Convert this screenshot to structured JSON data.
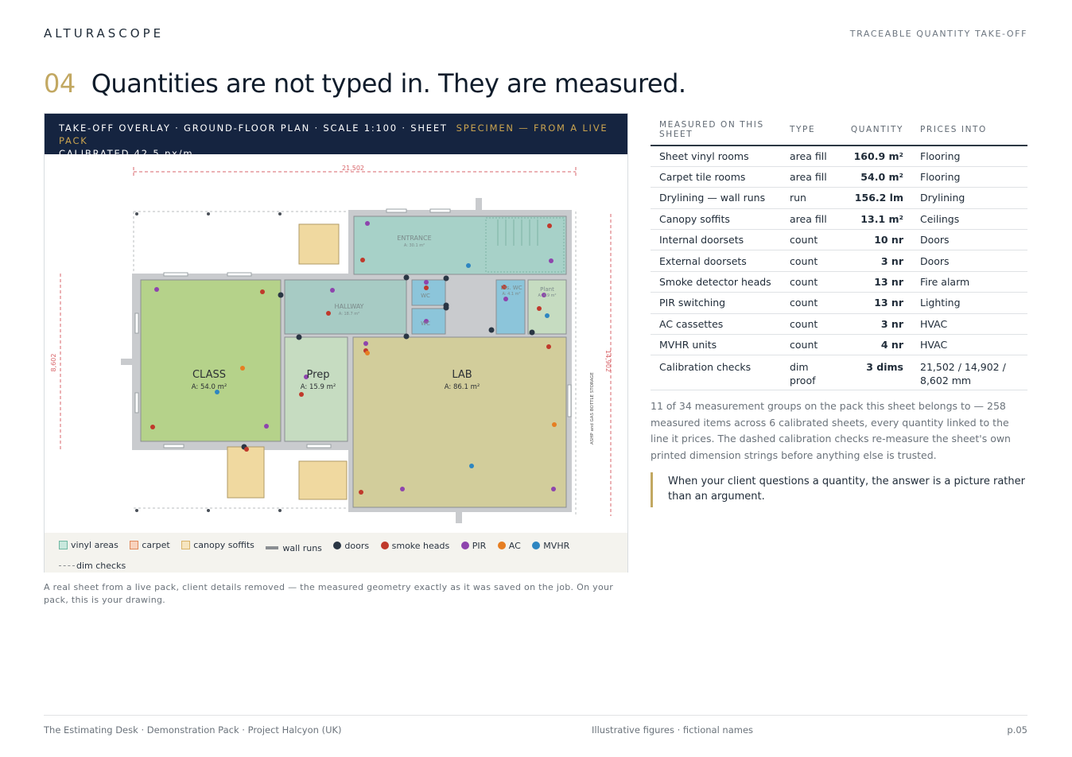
{
  "brand": "ALTURASCOPE",
  "kicker": "TRACEABLE QUANTITY TAKE-OFF",
  "headline": {
    "number": "04",
    "text": "Quantities are not typed in. They are measured."
  },
  "panel": {
    "header_main": "TAKE-OFF OVERLAY  ·  GROUND-FLOOR PLAN  ·  SCALE 1:100  ·  SHEET",
    "header_specimen": "SPECIMEN — FROM A LIVE PACK",
    "header_line2": "CALIBRATED 42.5 px/m"
  },
  "plan": {
    "rooms": [
      {
        "name": "CLASS",
        "area": "A: 54.0 m²"
      },
      {
        "name": "Prep",
        "area": "A: 15.9 m²"
      },
      {
        "name": "LAB",
        "area": "A: 86.1 m²"
      },
      {
        "name": "ENTRANCE",
        "area": "A: 30.1 m²"
      },
      {
        "name": "HALLWAY",
        "area": "A: 18.7 m²"
      },
      {
        "name": "Dis. WC",
        "area": "A: 4.1 m²"
      },
      {
        "name": "Plant",
        "area": "A: 4.9 m²"
      },
      {
        "name": "WC",
        "area": ""
      },
      {
        "name": "WC",
        "area": ""
      }
    ],
    "dims": [
      "21,502",
      "14,902",
      "8,602"
    ],
    "side_note": "ASHP and GAS BOTTLE STORAGE",
    "colors": {
      "vinyl": "#9fcfc0",
      "carpet": "#f0a983",
      "canopy": "#f0d9a0",
      "wall": "#8a8e92",
      "doors": "#2a3644",
      "smoke": "#c0392b",
      "pir": "#8e44ad",
      "ac": "#e67e22",
      "mvhr": "#2e86c1"
    }
  },
  "legend": [
    "vinyl areas",
    "carpet",
    "canopy soffits",
    "wall runs",
    "doors",
    "smoke heads",
    "PIR",
    "AC",
    "MVHR",
    "dim checks"
  ],
  "caption": "A real sheet from a live pack, client details removed — the measured geometry exactly as it was saved on the job. On your pack, this is your drawing.",
  "table": {
    "headers": [
      "MEASURED ON THIS SHEET",
      "TYPE",
      "QUANTITY",
      "PRICES INTO"
    ],
    "rows": [
      [
        "Sheet vinyl rooms",
        "area fill",
        "160.9 m²",
        "Flooring"
      ],
      [
        "Carpet tile rooms",
        "area fill",
        "54.0 m²",
        "Flooring"
      ],
      [
        "Drylining — wall runs",
        "run",
        "156.2 lm",
        "Drylining"
      ],
      [
        "Canopy soffits",
        "area fill",
        "13.1 m²",
        "Ceilings"
      ],
      [
        "Internal doorsets",
        "count",
        "10 nr",
        "Doors"
      ],
      [
        "External doorsets",
        "count",
        "3 nr",
        "Doors"
      ],
      [
        "Smoke detector heads",
        "count",
        "13 nr",
        "Fire alarm"
      ],
      [
        "PIR switching",
        "count",
        "13 nr",
        "Lighting"
      ],
      [
        "AC cassettes",
        "count",
        "3 nr",
        "HVAC"
      ],
      [
        "MVHR units",
        "count",
        "4 nr",
        "HVAC"
      ],
      [
        "Calibration checks",
        "dim proof",
        "3 dims",
        "21,502 / 14,902 / 8,602 mm"
      ]
    ]
  },
  "body_text": "11 of 34 measurement groups on the pack this sheet belongs to — 258 measured items across 6 calibrated sheets, every quantity linked to the line it prices. The dashed calibration checks re-measure the sheet's own printed dimension strings before anything else is trusted.",
  "quote": "When your client questions a quantity, the answer is a picture rather than an argument.",
  "footer": {
    "left": "The Estimating Desk · Demonstration Pack · Project Halcyon (UK)",
    "center": "Illustrative figures · fictional names",
    "right": "p.05"
  }
}
